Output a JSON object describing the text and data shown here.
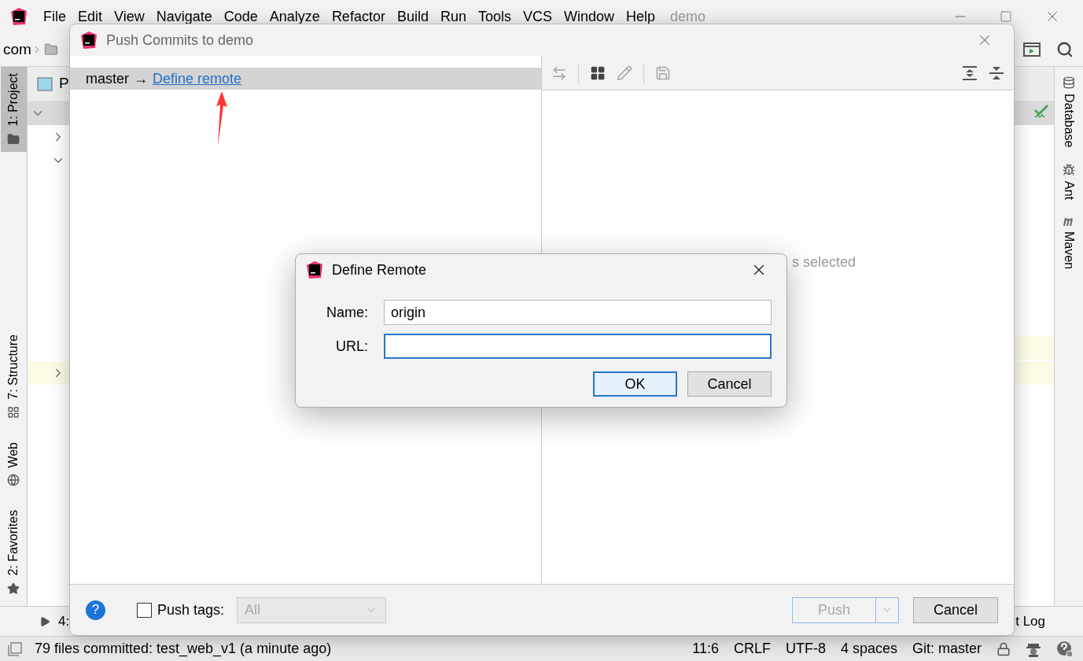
{
  "ide": {
    "menu": [
      "File",
      "Edit",
      "View",
      "Navigate",
      "Code",
      "Analyze",
      "Refactor",
      "Build",
      "Run",
      "Tools",
      "VCS",
      "Window",
      "Help"
    ],
    "title": "demo",
    "breadcrumb": "com",
    "project_tab": "P",
    "left_tools": [
      {
        "label": "1: Project",
        "selected": true,
        "kind": "folder"
      },
      {
        "label": "7: Structure",
        "selected": false,
        "kind": "structure"
      },
      {
        "label": "Web",
        "selected": false,
        "kind": "globe"
      },
      {
        "label": "2: Favorites",
        "selected": false,
        "kind": "star"
      }
    ],
    "right_tools": [
      {
        "label": "Database",
        "kind": "database"
      },
      {
        "label": "Ant",
        "kind": "bug"
      },
      {
        "label": "Maven",
        "kind": "maven"
      }
    ],
    "bottom_tools": [
      "4:",
      "t Log"
    ],
    "status": {
      "message": "79 files committed: test_web_v1 (a minute ago)",
      "items": [
        "11:6",
        "CRLF",
        "UTF-8",
        "4 spaces",
        "Git: master"
      ]
    }
  },
  "push_dialog": {
    "title": "Push Commits to demo",
    "branch": "master",
    "arrow": "→",
    "link": "Define remote",
    "empty_text": "s selected",
    "help": "?",
    "push_tags": {
      "label": "Push tags:",
      "checked": false
    },
    "tags_select": {
      "value": "All",
      "disabled": true
    },
    "push_button": {
      "label": "Push",
      "disabled": true
    },
    "cancel": "Cancel"
  },
  "remote_dialog": {
    "title": "Define Remote",
    "fields": [
      {
        "label": "Name:",
        "value": "origin",
        "focused": false
      },
      {
        "label": "URL:",
        "focused": true
      }
    ],
    "buttons": [
      {
        "label": "OK",
        "default": true
      },
      {
        "label": "Cancel",
        "default": false
      }
    ]
  }
}
